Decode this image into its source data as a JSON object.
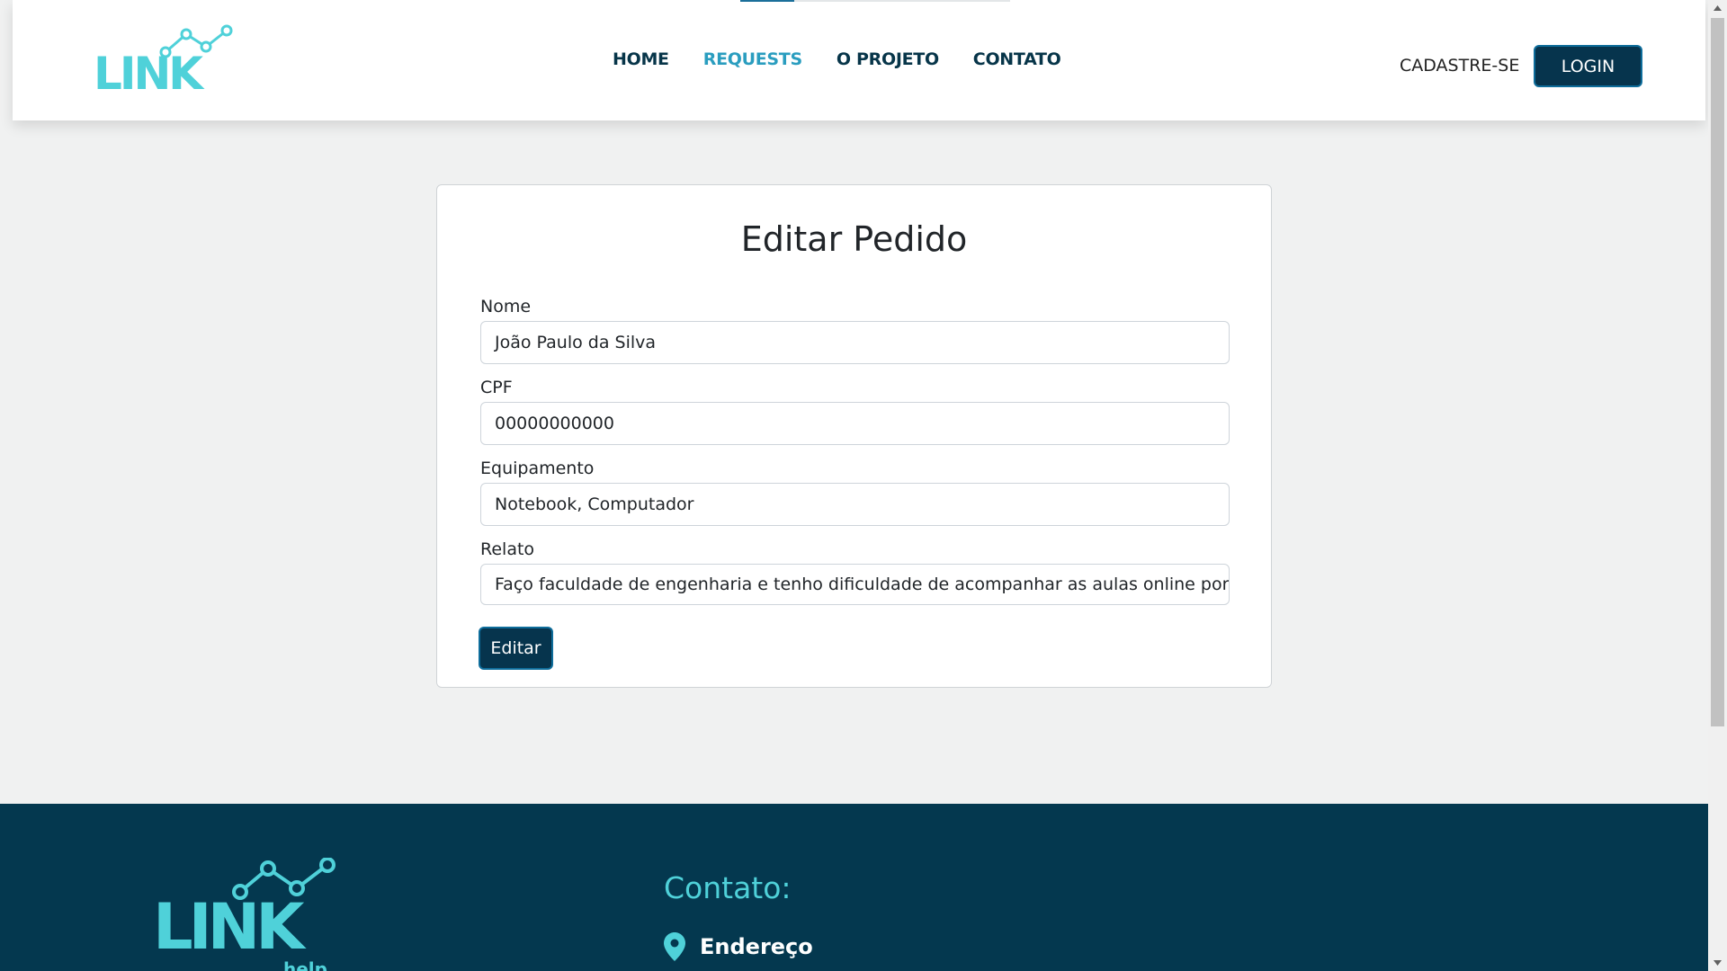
{
  "header": {
    "logo_text": "LINK",
    "nav": [
      {
        "label": "HOME"
      },
      {
        "label": "REQUESTS"
      },
      {
        "label": "O PROJETO"
      },
      {
        "label": "CONTATO"
      }
    ],
    "active_nav": "REQUESTS",
    "signup_label": "CADASTRE-SE",
    "login_label": "LOGIN",
    "page_load_progress": 0.2
  },
  "form": {
    "title": "Editar Pedido",
    "fields": [
      {
        "label": "Nome",
        "value": "João Paulo da Silva"
      },
      {
        "label": "CPF",
        "value": "00000000000"
      },
      {
        "label": "Equipamento",
        "value": "Notebook, Computador"
      },
      {
        "label": "Relato",
        "value": "Faço faculdade de engenharia e tenho dificuldade de acompanhar as aulas online por não"
      }
    ],
    "submit_label": "Editar"
  },
  "footer": {
    "logo_text": "LINK",
    "logo_sub": "help",
    "contact_title": "Contato:",
    "address_label": "Endereço",
    "address_icon": "map-pin-icon"
  },
  "colors": {
    "brand_dark": "#06344d",
    "brand_cyan": "#4fd1d9",
    "nav_active": "#2a9dbf",
    "footer_bg": "#04384f"
  }
}
